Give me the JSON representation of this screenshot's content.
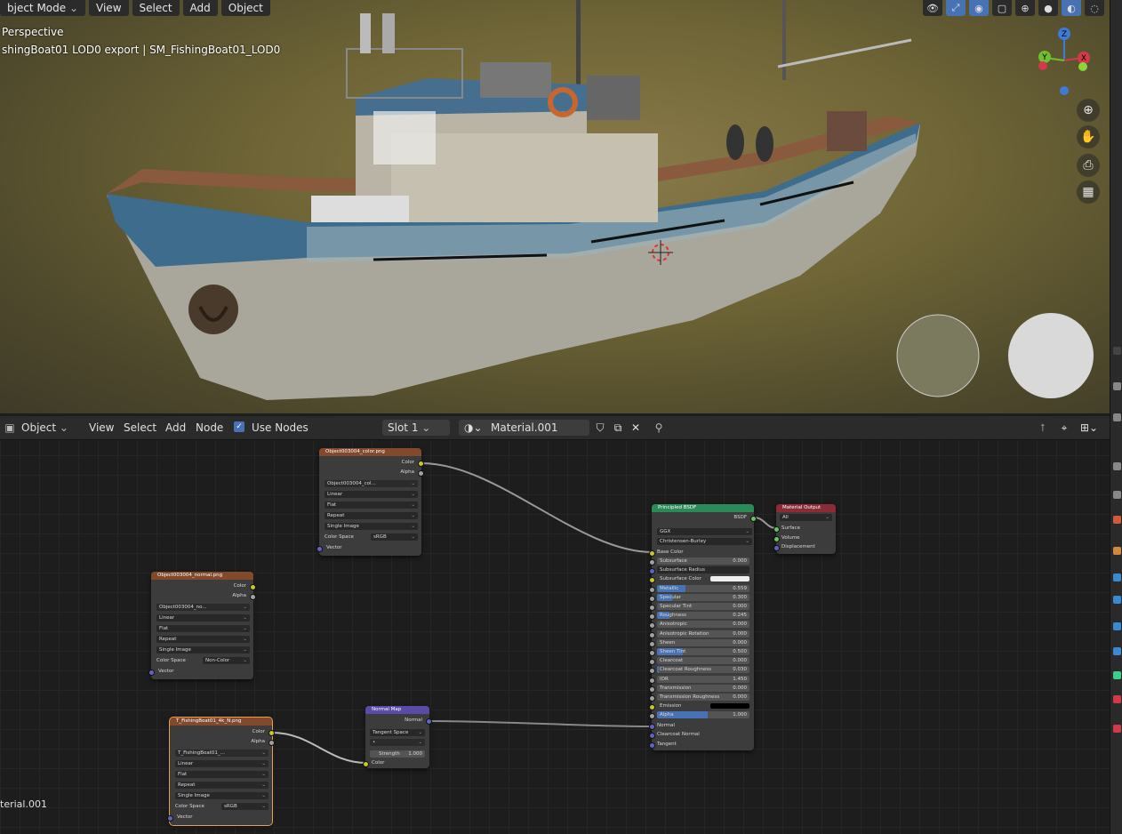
{
  "viewport": {
    "menu": [
      "bject Mode",
      "View",
      "Select",
      "Add",
      "Object"
    ],
    "view_label": "Perspective",
    "object_info": "shingBoat01 LOD0 export | SM_FishingBoat01_LOD0",
    "gizmo": {
      "z": "Z",
      "x": "X",
      "y": "Y"
    }
  },
  "node_header": {
    "editor_type": "Object",
    "view": "View",
    "select": "Select",
    "add": "Add",
    "node": "Node",
    "use_nodes": "Use Nodes",
    "slot": "Slot 1",
    "material": "Material.001"
  },
  "material_label": "terial.001",
  "nodes": {
    "color_tex": {
      "title": "Object003004_color.png",
      "out_color": "Color",
      "out_alpha": "Alpha",
      "file": "Object003004_col...",
      "interp": "Linear",
      "proj": "Flat",
      "ext": "Repeat",
      "source": "Single Image",
      "cs_label": "Color Space",
      "cs_value": "sRGB",
      "in_vector": "Vector"
    },
    "normal_tex": {
      "title": "Object003004_normal.png",
      "out_color": "Color",
      "out_alpha": "Alpha",
      "file": "Object003004_no...",
      "interp": "Linear",
      "proj": "Flat",
      "ext": "Repeat",
      "source": "Single Image",
      "cs_label": "Color Space",
      "cs_value": "Non-Color",
      "in_vector": "Vector"
    },
    "n_tex": {
      "title": "T_FishingBoat01_4k_N.png",
      "out_color": "Color",
      "out_alpha": "Alpha",
      "file": "T_FishingBoat01_...",
      "interp": "Linear",
      "proj": "Flat",
      "ext": "Repeat",
      "source": "Single Image",
      "cs_label": "Color Space",
      "cs_value": "sRGB",
      "in_vector": "Vector"
    },
    "normal_map": {
      "title": "Normal Map",
      "out_normal": "Normal",
      "space": "Tangent Space",
      "uv": "•",
      "strength_label": "Strength",
      "strength_value": "1.000",
      "in_color": "Color"
    },
    "bsdf": {
      "title": "Principled BSDF",
      "out": "BSDF",
      "dist": "GGX",
      "sss_method": "Christensen-Burley",
      "base_color": "Base Color",
      "sliders": [
        {
          "label": "Subsurface",
          "value": "0.000",
          "fill": 0
        },
        {
          "label": "Subsurface Radius",
          "value": "",
          "fill": 0
        },
        {
          "label": "Subsurface Color",
          "value": "",
          "fill": 0
        },
        {
          "label": "Metallic",
          "value": "0.559",
          "fill": 0.559
        },
        {
          "label": "Specular",
          "value": "0.300",
          "fill": 0.3
        },
        {
          "label": "Specular Tint",
          "value": "0.000",
          "fill": 0
        },
        {
          "label": "Roughness",
          "value": "0.245",
          "fill": 0.245
        },
        {
          "label": "Anisotropic",
          "value": "0.000",
          "fill": 0
        },
        {
          "label": "Anisotropic Rotation",
          "value": "0.000",
          "fill": 0
        },
        {
          "label": "Sheen",
          "value": "0.000",
          "fill": 0
        },
        {
          "label": "Sheen Tint",
          "value": "0.500",
          "fill": 0.5
        },
        {
          "label": "Clearcoat",
          "value": "0.000",
          "fill": 0
        },
        {
          "label": "Clearcoat Roughness",
          "value": "0.030",
          "fill": 0.03
        },
        {
          "label": "IOR",
          "value": "1.450",
          "fill": 0
        },
        {
          "label": "Transmission",
          "value": "0.000",
          "fill": 0
        },
        {
          "label": "Transmission Roughness",
          "value": "0.000",
          "fill": 0
        },
        {
          "label": "Emission",
          "value": "",
          "fill": 0
        },
        {
          "label": "Alpha",
          "value": "1.000",
          "fill": 1
        }
      ],
      "normal": "Normal",
      "clearcoat_normal": "Clearcoat Normal",
      "tangent": "Tangent"
    },
    "output": {
      "title": "Material Output",
      "target": "All",
      "surface": "Surface",
      "volume": "Volume",
      "displacement": "Displacement"
    }
  },
  "colors": {
    "image_header": "#83492c",
    "shader_header": "#2b8a58",
    "output_header": "#8a2b35",
    "vector_header": "#5c4aa8",
    "accent": "#4772b3"
  }
}
